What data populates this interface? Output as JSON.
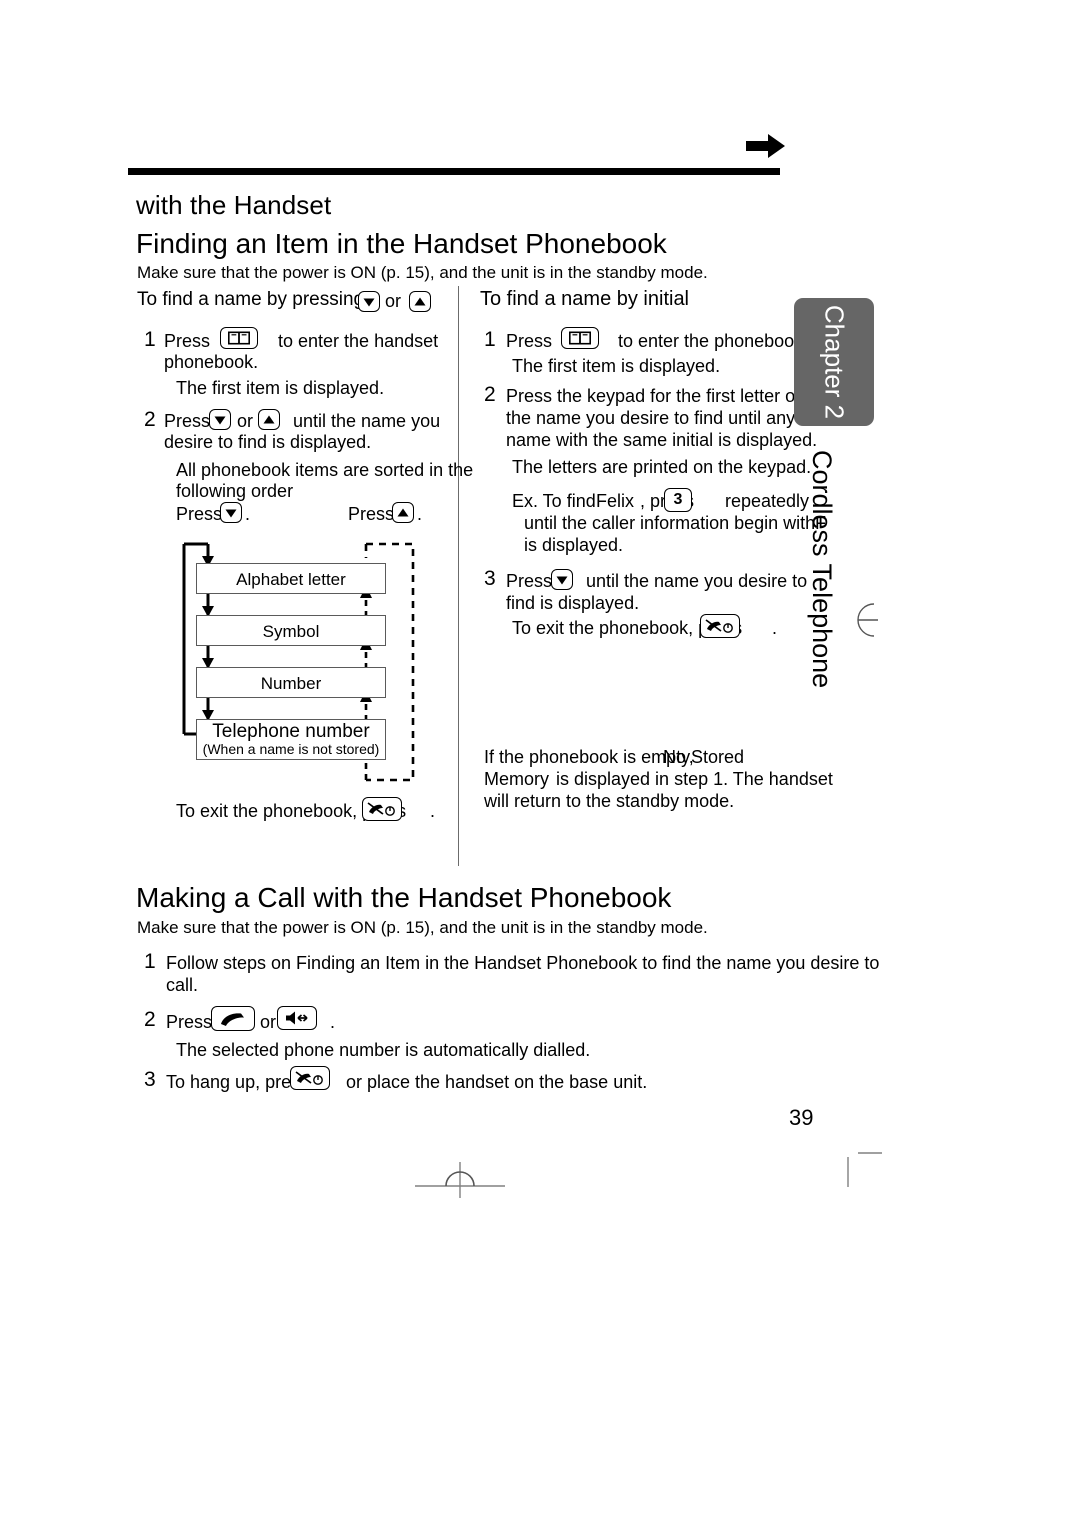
{
  "document": {
    "page_number": "39",
    "chapter_tab": "Chapter 2",
    "chapter_vertical_label": "Cordless Telephone"
  },
  "headings": {
    "continued_heading": "with the Handset",
    "section_heading": "Finding an Item in the Handset Phonebook",
    "section_lead": "Make sure that the power is ON (p. 15), and the unit is in the standby mode.",
    "second_section_heading": "Making a Call with the Handset Phonebook",
    "second_section_lead": "Make sure that the power is ON (p. 15), and the unit is in the standby mode."
  },
  "left_column": {
    "subheading_prefix": "To find a name by pressing",
    "subheading_or": "or",
    "step1_num": "1",
    "step1_press": "Press",
    "step1_text": "to enter the handset",
    "step1_text2": "phonebook.",
    "step1_note": "The first item is displayed.",
    "step2_num": "2",
    "step2_press": "Press",
    "step2_or": "or",
    "step2_text": "until the name you",
    "step2_text2": "desire to find is displayed.",
    "step2_note1": "All phonebook items are sorted in the",
    "step2_note2": "following order",
    "press_down_label": "Press",
    "press_down_period": ".",
    "press_up_label": "Press",
    "press_up_period": ".",
    "exit_text": "To exit the phonebook, press",
    "exit_period": "."
  },
  "flow_diagram": {
    "boxes": [
      {
        "label": "Alphabet letter",
        "sub": ""
      },
      {
        "label": "Symbol",
        "sub": ""
      },
      {
        "label": "Number",
        "sub": ""
      },
      {
        "label": "Telephone number",
        "sub": "(When a name is not stored)"
      }
    ]
  },
  "right_column": {
    "subheading": "To find a name by initial",
    "step1_num": "1",
    "step1_press": "Press",
    "step1_text": "to enter the phonebook.",
    "step1_note": "The first item is displayed.",
    "step2_num": "2",
    "step2_line1": "Press the keypad for the first letter of",
    "step2_line2": "the name you desire to find until any",
    "step2_line3": "name with the same initial is displayed.",
    "step2_note": "The letters are printed on the keypad.",
    "example_prefix": "Ex. To find",
    "example_name": "Felix",
    "example_mid": ", press",
    "example_key": "3",
    "example_suffix": "repeatedly",
    "example_line2": "until the caller information begin with",
    "example_letter": "F",
    "example_line3": "is displayed.",
    "step3_num": "3",
    "step3_press": "Press",
    "step3_text": "until the name you desire to",
    "step3_text2": "find is displayed.",
    "step3_exit": "To exit the phonebook, press",
    "step3_exit_period": ".",
    "empty_note1": "If the phonebook is empty,",
    "empty_note_overlap": "No Stored",
    "empty_note2": "Memory",
    "empty_note3": "is displayed in step 1. The handset",
    "empty_note4": "will return to the standby mode."
  },
  "making_call": {
    "step1_num": "1",
    "step1_line1": "Follow steps on Finding an Item in the Handset Phonebook to find the name you desire to",
    "step1_line2": "call.",
    "step2_num": "2",
    "step2_press": "Press",
    "step2_or": "or",
    "step2_period": ".",
    "step2_note": "The selected phone number is automatically dialled.",
    "step3_num": "3",
    "step3_prefix": "To hang up, press",
    "step3_suffix": "or place the handset on the base unit."
  },
  "icons": {
    "phonebook_key": "open-book-icon",
    "down_key": "triangle-down-icon",
    "up_key": "triangle-up-icon",
    "talk_key": "phone-handset-icon",
    "speaker_key": "speakerphone-icon",
    "off_key": "phone-off-icon",
    "top_arrow": "right-arrow-icon"
  },
  "colors": {
    "chapter_tab_bg": "#666666",
    "rule": "#000000",
    "box_border": "#5a5a5a",
    "divider": "#6b6b6b"
  }
}
